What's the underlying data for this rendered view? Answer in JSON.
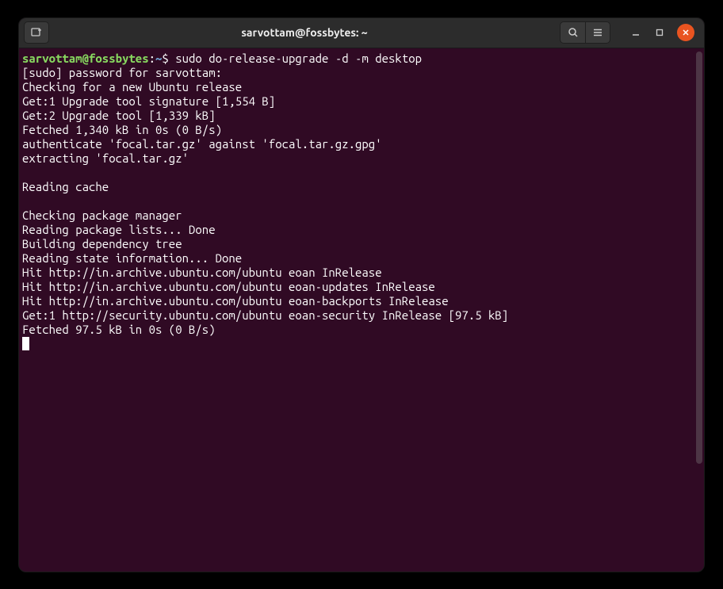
{
  "titlebar": {
    "title": "sarvottam@fossbytes: ~"
  },
  "terminal": {
    "prompt": {
      "user_host": "sarvottam@fossbytes",
      "separator": ":",
      "path": "~",
      "symbol": "$"
    },
    "command": "sudo do-release-upgrade -d -m desktop",
    "output": [
      "[sudo] password for sarvottam: ",
      "Checking for a new Ubuntu release",
      "Get:1 Upgrade tool signature [1,554 B]",
      "Get:2 Upgrade tool [1,339 kB]",
      "Fetched 1,340 kB in 0s (0 B/s)",
      "authenticate 'focal.tar.gz' against 'focal.tar.gz.gpg'",
      "extracting 'focal.tar.gz'",
      "",
      "Reading cache",
      "",
      "Checking package manager",
      "Reading package lists... Done",
      "Building dependency tree",
      "Reading state information... Done",
      "Hit http://in.archive.ubuntu.com/ubuntu eoan InRelease",
      "Hit http://in.archive.ubuntu.com/ubuntu eoan-updates InRelease",
      "Hit http://in.archive.ubuntu.com/ubuntu eoan-backports InRelease",
      "Get:1 http://security.ubuntu.com/ubuntu eoan-security InRelease [97.5 kB]",
      "Fetched 97.5 kB in 0s (0 B/s)"
    ]
  }
}
